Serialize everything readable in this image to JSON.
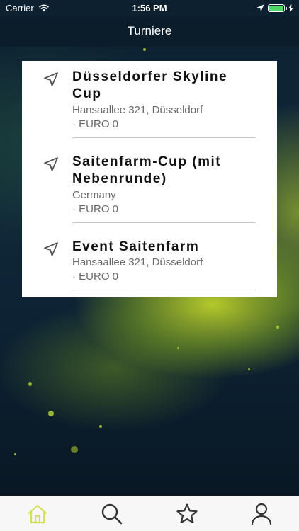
{
  "status_bar": {
    "carrier": "Carrier",
    "time": "1:56 PM",
    "battery_level": 1.0
  },
  "nav": {
    "title": "Turniere"
  },
  "tournaments": [
    {
      "title": "Düsseldorfer Skyline Cup",
      "location": "Hansaallee 321, Düsseldorf",
      "price": "· EURO 0",
      "icon": "location-arrow-icon"
    },
    {
      "title": "Saitenfarm-Cup (mit Nebenrunde)",
      "location": "Germany",
      "price": "· EURO 0",
      "icon": "location-arrow-icon"
    },
    {
      "title": "Event Saitenfarm",
      "location": "Hansaallee 321, Düsseldorf",
      "price": "· EURO 0",
      "icon": "location-arrow-icon"
    }
  ],
  "tab_bar": {
    "items": [
      {
        "icon": "home-icon",
        "active": true
      },
      {
        "icon": "search-icon",
        "active": false
      },
      {
        "icon": "star-icon",
        "active": false
      },
      {
        "icon": "profile-icon",
        "active": false
      }
    ],
    "active_color": "#d4e157",
    "inactive_color": "#333333"
  }
}
